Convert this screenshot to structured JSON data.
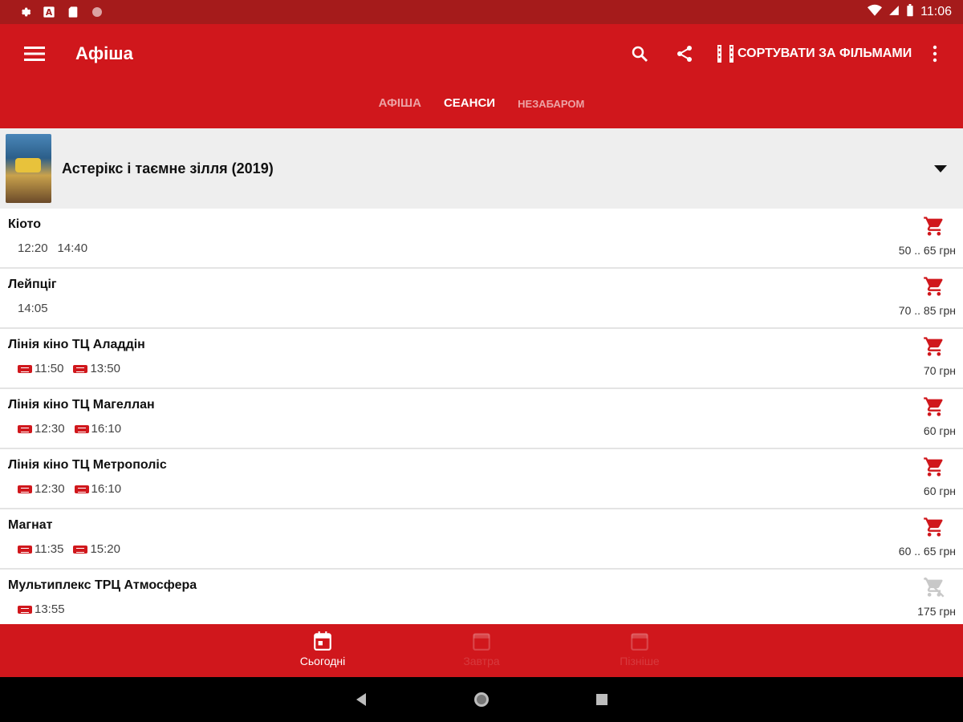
{
  "status_bar": {
    "time": "11:06",
    "left_icons": [
      "gear-icon",
      "a-icon",
      "sd-icon",
      "circle-icon"
    ],
    "right_icons": [
      "wifi-icon",
      "signal-icon",
      "battery-icon"
    ]
  },
  "app_bar": {
    "title": "Афіша",
    "sort_label": "СОРТУВАТИ ЗА ФІЛЬМАМИ",
    "tabs": [
      {
        "label": "АФІША",
        "active": false
      },
      {
        "label": "СЕАНСИ",
        "active": true
      },
      {
        "label": "НЕЗАБАРОМ",
        "active": false
      }
    ]
  },
  "movie": {
    "title": "Астерікс і таємне зілля (2019)"
  },
  "cinemas": [
    {
      "name": "Кіото",
      "times": [
        "12:20",
        "14:40"
      ],
      "is3d": false,
      "price": "50 .. 65 грн",
      "available": true
    },
    {
      "name": "Лейпціг",
      "times": [
        "14:05"
      ],
      "is3d": false,
      "price": "70 .. 85 грн",
      "available": true
    },
    {
      "name": "Лінія кіно ТЦ Аладдін",
      "times": [
        "11:50",
        "13:50"
      ],
      "is3d": true,
      "price": "70 грн",
      "available": true
    },
    {
      "name": "Лінія кіно ТЦ Магеллан",
      "times": [
        "12:30",
        "16:10"
      ],
      "is3d": true,
      "price": "60 грн",
      "available": true
    },
    {
      "name": "Лінія кіно ТЦ Метрополіс",
      "times": [
        "12:30",
        "16:10"
      ],
      "is3d": true,
      "price": "60 грн",
      "available": true
    },
    {
      "name": "Магнат",
      "times": [
        "11:35",
        "15:20"
      ],
      "is3d": true,
      "price": "60 .. 65 грн",
      "available": true
    },
    {
      "name": "Мультиплекс ТРЦ Атмосфера",
      "times": [
        "13:55"
      ],
      "is3d": true,
      "price": "175 грн",
      "available": false
    }
  ],
  "bottom_nav": {
    "items": [
      {
        "label": "Сьогодні",
        "active": true
      },
      {
        "label": "Завтра",
        "active": false
      },
      {
        "label": "Пізніше",
        "active": false
      }
    ]
  },
  "colors": {
    "primary": "#d0171c",
    "status_bar": "#a51b1b",
    "movie_row_bg": "#eeeeee"
  }
}
